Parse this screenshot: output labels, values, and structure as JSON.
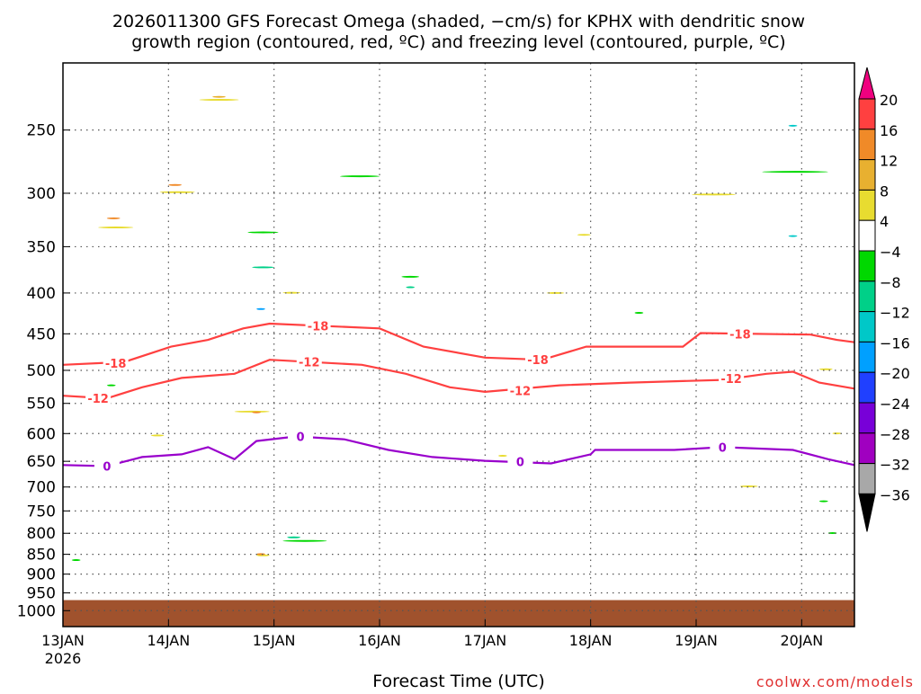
{
  "chart_data": {
    "type": "heatmap",
    "title_line1": "2026011300 GFS Forecast Omega (shaded, −cm/s) for KPHX with dendritic snow",
    "title_line2": "growth region (contoured, red, ºC) and freezing level (contoured, purple, ºC)",
    "xlabel": "Forecast Time (UTC)",
    "ylabel": "",
    "watermark": "coolwx.com/models",
    "x_units": "forecast hours",
    "xlim": [
      0,
      180
    ],
    "ylim_hpa": [
      1047,
      206
    ],
    "y_scale": "log",
    "x_ticks": [
      {
        "h": 0,
        "label": "13JAN",
        "sub": "2026"
      },
      {
        "h": 24,
        "label": "14JAN"
      },
      {
        "h": 48,
        "label": "15JAN"
      },
      {
        "h": 72,
        "label": "16JAN"
      },
      {
        "h": 96,
        "label": "17JAN"
      },
      {
        "h": 120,
        "label": "18JAN"
      },
      {
        "h": 144,
        "label": "19JAN"
      },
      {
        "h": 168,
        "label": "20JAN"
      }
    ],
    "y_ticks": [
      250,
      300,
      350,
      400,
      450,
      500,
      550,
      600,
      650,
      700,
      750,
      800,
      850,
      900,
      950,
      1000
    ],
    "grid": true,
    "ground_top_hpa": 970,
    "ground_color": "#a0522d",
    "colorbar": {
      "levels": [
        "20",
        "16",
        "12",
        "8",
        "4",
        "−4",
        "−8",
        "−12",
        "−16",
        "−20",
        "−24",
        "−28",
        "−32",
        "−36"
      ],
      "top_arrow_color": "#f0007f",
      "bottom_arrow_color": "#000000",
      "colors": [
        "#ff4040",
        "#f08a28",
        "#e8b030",
        "#e8dc30",
        "#ffffff",
        "#00d800",
        "#00d088",
        "#00c8c8",
        "#00a0ff",
        "#2040ff",
        "#7800d8",
        "#a000c0",
        "#a8a8a8"
      ]
    },
    "omega_cells": [
      {
        "t": [
          8,
          16
        ],
        "p": [
          215,
          510
        ],
        "c": "#e8dc30"
      },
      {
        "t": [
          10,
          13
        ],
        "p": [
          260,
          400
        ],
        "c": "#f08a28"
      },
      {
        "t": [
          22,
          30
        ],
        "p": [
          208,
          430
        ],
        "c": "#e8dc30"
      },
      {
        "t": [
          24,
          27
        ],
        "p": [
          260,
          330
        ],
        "c": "#f08a28"
      },
      {
        "t": [
          31,
          40
        ],
        "p": [
          210,
          250
        ],
        "c": "#e8dc30"
      },
      {
        "t": [
          34,
          37
        ],
        "p": [
          215,
          240
        ],
        "c": "#e8b030"
      },
      {
        "t": [
          42,
          49
        ],
        "p": [
          235,
          480
        ],
        "c": "#00d800"
      },
      {
        "t": [
          43,
          48
        ],
        "p": [
          300,
          460
        ],
        "c": "#00d088"
      },
      {
        "t": [
          44,
          46
        ],
        "p": [
          390,
          450
        ],
        "c": "#00a0ff"
      },
      {
        "t": [
          50,
          54
        ],
        "p": [
          340,
          470
        ],
        "c": "#e8dc30"
      },
      {
        "t": [
          63,
          72
        ],
        "p": [
          240,
          340
        ],
        "c": "#00d800"
      },
      {
        "t": [
          77,
          81
        ],
        "p": [
          310,
          470
        ],
        "c": "#00d800"
      },
      {
        "t": [
          78,
          80
        ],
        "p": [
          360,
          430
        ],
        "c": "#00d088"
      },
      {
        "t": [
          110,
          114
        ],
        "p": [
          320,
          500
        ],
        "c": "#e8dc30"
      },
      {
        "t": [
          117,
          120
        ],
        "p": [
          260,
          440
        ],
        "c": "#e8dc30"
      },
      {
        "t": [
          143,
          153
        ],
        "p": [
          245,
          370
        ],
        "c": "#e8dc30"
      },
      {
        "t": [
          159,
          174
        ],
        "p": [
          215,
          370
        ],
        "c": "#00d800"
      },
      {
        "t": [
          165,
          167
        ],
        "p": [
          230,
          265
        ],
        "c": "#00c8c8"
      },
      {
        "t": [
          165,
          167
        ],
        "p": [
          320,
          360
        ],
        "c": "#00c8c8"
      },
      {
        "t": [
          130,
          132
        ],
        "p": [
          390,
          460
        ],
        "c": "#00d800"
      },
      {
        "t": [
          10,
          12
        ],
        "p": [
          470,
          580
        ],
        "c": "#00d800"
      },
      {
        "t": [
          20,
          23
        ],
        "p": [
          520,
          700
        ],
        "c": "#e8dc30"
      },
      {
        "t": [
          39,
          47
        ],
        "p": [
          520,
          610
        ],
        "c": "#e8dc30"
      },
      {
        "t": [
          43,
          45
        ],
        "p": [
          540,
          590
        ],
        "c": "#f08a28"
      },
      {
        "t": [
          44,
          47
        ],
        "p": [
          790,
          920
        ],
        "c": "#e8dc30"
      },
      {
        "t": [
          44,
          46
        ],
        "p": [
          820,
          880
        ],
        "c": "#f08a28"
      },
      {
        "t": [
          50,
          60
        ],
        "p": [
          760,
          880
        ],
        "c": "#00d800"
      },
      {
        "t": [
          51,
          54
        ],
        "p": [
          780,
          840
        ],
        "c": "#00d088"
      },
      {
        "t": [
          154,
          158
        ],
        "p": [
          610,
          800
        ],
        "c": "#e8dc30"
      },
      {
        "t": [
          172,
          175
        ],
        "p": [
          460,
          540
        ],
        "c": "#e8dc30"
      },
      {
        "t": [
          175,
          177
        ],
        "p": [
          580,
          620
        ],
        "c": "#e8dc30"
      },
      {
        "t": [
          172,
          174
        ],
        "p": [
          700,
          760
        ],
        "c": "#00d800"
      },
      {
        "t": [
          174,
          176
        ],
        "p": [
          770,
          830
        ],
        "c": "#00d800"
      },
      {
        "t": [
          2,
          4
        ],
        "p": [
          830,
          900
        ],
        "c": "#00d800"
      },
      {
        "t": [
          99,
          101
        ],
        "p": [
          620,
          660
        ],
        "c": "#e8dc30"
      }
    ],
    "contours": [
      {
        "name": "dgz-minus18",
        "label": "-18",
        "color": "#ff4040",
        "points": [
          [
            0,
            492
          ],
          [
            14,
            488
          ],
          [
            24.6,
            467
          ],
          [
            33,
            458
          ],
          [
            41,
            443
          ],
          [
            47,
            437
          ],
          [
            72,
            443
          ],
          [
            82,
            467
          ],
          [
            96,
            482
          ],
          [
            109,
            485
          ],
          [
            119,
            467
          ],
          [
            141,
            467
          ],
          [
            145,
            449
          ],
          [
            170,
            451
          ],
          [
            176,
            458
          ],
          [
            180,
            461
          ]
        ],
        "label_at": [
          [
            12,
            490
          ],
          [
            58,
            440
          ],
          [
            108,
            485
          ],
          [
            154,
            450
          ]
        ]
      },
      {
        "name": "dgz-minus12",
        "label": "-12",
        "color": "#ff4040",
        "points": [
          [
            0,
            538
          ],
          [
            10,
            542
          ],
          [
            18,
            525
          ],
          [
            27,
            511
          ],
          [
            39,
            505
          ],
          [
            47,
            485
          ],
          [
            68,
            492
          ],
          [
            78,
            505
          ],
          [
            88,
            525
          ],
          [
            96,
            532
          ],
          [
            113,
            522
          ],
          [
            129,
            518
          ],
          [
            150,
            514
          ],
          [
            160,
            505
          ],
          [
            166,
            502
          ],
          [
            172,
            518
          ],
          [
            180,
            527
          ]
        ],
        "label_at": [
          [
            8,
            542
          ],
          [
            56,
            488
          ],
          [
            104,
            530
          ],
          [
            152,
            512
          ]
        ]
      },
      {
        "name": "freezing-level-0",
        "label": "0",
        "color": "#9900cc",
        "points": [
          [
            0,
            657
          ],
          [
            10,
            659
          ],
          [
            18,
            642
          ],
          [
            27,
            637
          ],
          [
            33,
            624
          ],
          [
            39,
            646
          ],
          [
            44,
            613
          ],
          [
            53,
            605
          ],
          [
            64,
            610
          ],
          [
            74,
            629
          ],
          [
            84,
            642
          ],
          [
            96,
            649
          ],
          [
            111,
            654
          ],
          [
            120,
            637
          ],
          [
            121,
            629
          ],
          [
            139,
            629
          ],
          [
            150,
            624
          ],
          [
            166,
            629
          ],
          [
            174,
            646
          ],
          [
            180,
            657
          ]
        ],
        "label_at": [
          [
            10,
            659
          ],
          [
            54,
            605
          ],
          [
            104,
            651
          ],
          [
            150,
            624
          ]
        ]
      }
    ]
  }
}
